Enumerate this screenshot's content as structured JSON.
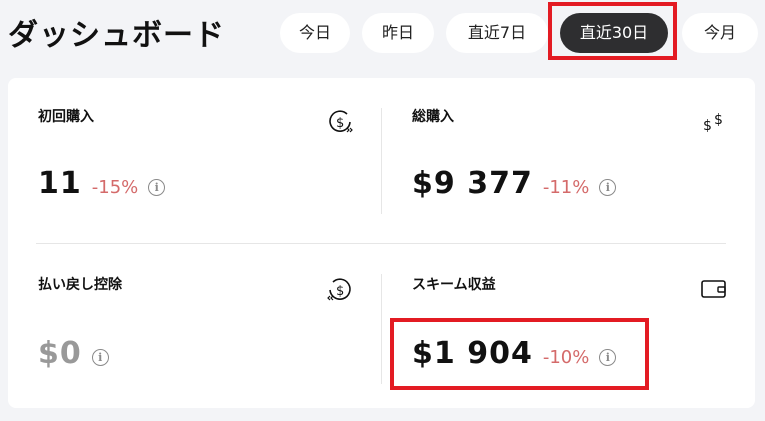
{
  "header": {
    "title": "ダッシュボード",
    "tabs": [
      {
        "label": "今日",
        "active": false
      },
      {
        "label": "昨日",
        "active": false
      },
      {
        "label": "直近7日",
        "active": false
      },
      {
        "label": "直近30日",
        "active": true
      },
      {
        "label": "今月",
        "active": false
      }
    ]
  },
  "metrics": {
    "first_purchase": {
      "label": "初回購入",
      "value": "11",
      "change": "-15%",
      "icon": "dollar-cycle-icon"
    },
    "total_purchase": {
      "label": "総購入",
      "value": "$9 377",
      "change": "-11%",
      "icon": "double-dollar-icon"
    },
    "refund_deduction": {
      "label": "払い戻し控除",
      "value": "$0",
      "change": "",
      "icon": "dollar-refund-icon"
    },
    "scheme_revenue": {
      "label": "スキーム収益",
      "value": "$1 904",
      "change": "-10%",
      "icon": "wallet-icon"
    }
  },
  "colors": {
    "active_tab_bg": "#2e2e30",
    "negative_change": "#d46a6a",
    "highlight": "#e31b23"
  }
}
